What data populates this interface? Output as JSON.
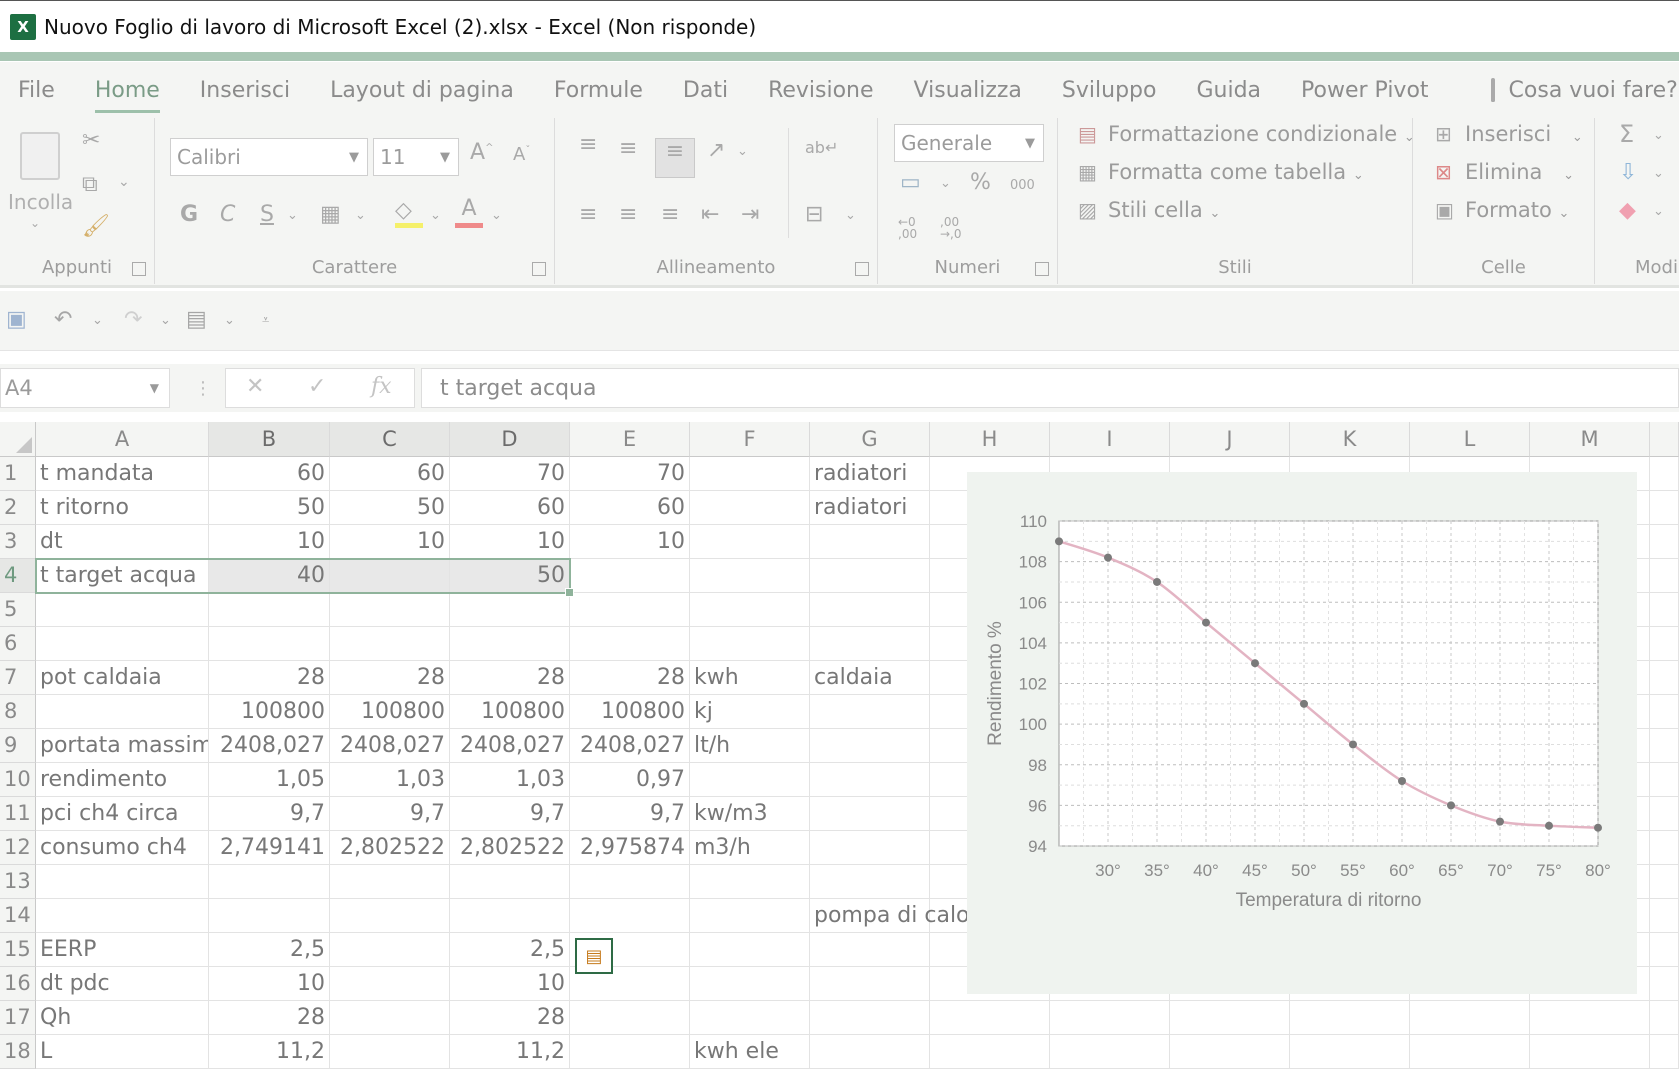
{
  "window": {
    "title": "Nuovo Foglio di lavoro di Microsoft Excel (2).xlsx - Excel (Non risponde)",
    "logo_letter": "X"
  },
  "ribbon_tabs": [
    "File",
    "Home",
    "Inserisci",
    "Layout di pagina",
    "Formule",
    "Dati",
    "Revisione",
    "Visualizza",
    "Sviluppo",
    "Guida",
    "Power Pivot"
  ],
  "tell_me": "Cosa vuoi fare?",
  "ribbon": {
    "appunti": {
      "paste_label": "Incolla",
      "group_label": "Appunti"
    },
    "carattere": {
      "font": "Calibri",
      "size": "11",
      "bold": "G",
      "italic": "C",
      "underline": "S",
      "group_label": "Carattere"
    },
    "allineamento": {
      "group_label": "Allineamento"
    },
    "numeri": {
      "format": "Generale",
      "percent": "%",
      "thousands": "000",
      "inc_dec": "←0 ,00",
      "dec_dec": ",00 →,0",
      "group_label": "Numeri"
    },
    "stili": {
      "conditional": "Formattazione condizionale",
      "as_table": "Formatta come tabella",
      "cell_styles": "Stili cella",
      "group_label": "Stili"
    },
    "celle": {
      "insert": "Inserisci",
      "delete": "Elimina",
      "format": "Formato",
      "group_label": "Celle"
    },
    "modifica": {
      "group_label": "Modi"
    }
  },
  "formula_bar": {
    "name_box": "A4",
    "formula": "t target acqua",
    "fx": "fx"
  },
  "columns": [
    "A",
    "B",
    "C",
    "D",
    "E",
    "F",
    "G",
    "H",
    "I",
    "J",
    "K",
    "L",
    "M"
  ],
  "rows": [
    {
      "n": "1",
      "A": "t mandata",
      "B": "60",
      "C": "60",
      "D": "70",
      "E": "70",
      "F": "",
      "G": "radiatori"
    },
    {
      "n": "2",
      "A": "t ritorno",
      "B": "50",
      "C": "50",
      "D": "60",
      "E": "60",
      "F": "",
      "G": "radiatori"
    },
    {
      "n": "3",
      "A": "dt",
      "B": "10",
      "C": "10",
      "D": "10",
      "E": "10",
      "F": "",
      "G": ""
    },
    {
      "n": "4",
      "A": "t target acqua",
      "B": "40",
      "C": "",
      "D": "50",
      "E": "",
      "F": "",
      "G": ""
    },
    {
      "n": "5",
      "A": "",
      "B": "",
      "C": "",
      "D": "",
      "E": "",
      "F": "",
      "G": ""
    },
    {
      "n": "6",
      "A": "",
      "B": "",
      "C": "",
      "D": "",
      "E": "",
      "F": "",
      "G": ""
    },
    {
      "n": "7",
      "A": "pot caldaia",
      "B": "28",
      "C": "28",
      "D": "28",
      "E": "28",
      "F": "kwh",
      "G": "caldaia"
    },
    {
      "n": "8",
      "A": "",
      "B": "100800",
      "C": "100800",
      "D": "100800",
      "E": "100800",
      "F": "kj",
      "G": ""
    },
    {
      "n": "9",
      "A": "portata massima",
      "B": "2408,027",
      "C": "2408,027",
      "D": "2408,027",
      "E": "2408,027",
      "F": "lt/h",
      "G": ""
    },
    {
      "n": "10",
      "A": "rendimento",
      "B": "1,05",
      "C": "1,03",
      "D": "1,03",
      "E": "0,97",
      "F": "",
      "G": ""
    },
    {
      "n": "11",
      "A": "pci ch4 circa",
      "B": "9,7",
      "C": "9,7",
      "D": "9,7",
      "E": "9,7",
      "F": "kw/m3",
      "G": ""
    },
    {
      "n": "12",
      "A": "consumo ch4",
      "B": "2,749141",
      "C": "2,802522",
      "D": "2,802522",
      "E": "2,975874",
      "F": "m3/h",
      "G": ""
    },
    {
      "n": "13",
      "A": "",
      "B": "",
      "C": "",
      "D": "",
      "E": "",
      "F": "",
      "G": ""
    },
    {
      "n": "14",
      "A": "",
      "B": "",
      "C": "",
      "D": "",
      "E": "",
      "F": "",
      "G": "pompa di calo"
    },
    {
      "n": "15",
      "A": "EERP",
      "B": "2,5",
      "C": "",
      "D": "2,5",
      "E": "",
      "F": "",
      "G": ""
    },
    {
      "n": "16",
      "A": "dt pdc",
      "B": "10",
      "C": "",
      "D": "10",
      "E": "",
      "F": "",
      "G": ""
    },
    {
      "n": "17",
      "A": "Qh",
      "B": "28",
      "C": "",
      "D": "28",
      "E": "",
      "F": "",
      "G": ""
    },
    {
      "n": "18",
      "A": "L",
      "B": "11,2",
      "C": "",
      "D": "11,2",
      "E": "",
      "F": "kwh ele",
      "G": ""
    }
  ],
  "chart_data": {
    "type": "line",
    "title": "",
    "xlabel": "Temperatura di ritorno",
    "ylabel": "Rendimento %",
    "x": [
      25,
      30,
      35,
      40,
      45,
      50,
      55,
      60,
      65,
      70,
      75,
      80
    ],
    "x_tick_labels": [
      "30°",
      "35°",
      "40°",
      "45°",
      "50°",
      "55°",
      "60°",
      "65°",
      "70°",
      "75°",
      "80°"
    ],
    "x_ticks": [
      30,
      35,
      40,
      45,
      50,
      55,
      60,
      65,
      70,
      75,
      80
    ],
    "y": [
      109,
      108.2,
      107,
      105,
      103,
      101,
      99,
      97.2,
      96,
      95.2,
      95,
      94.9
    ],
    "ylim": [
      94,
      110
    ],
    "xlim": [
      25,
      80
    ],
    "y_ticks": [
      94,
      96,
      98,
      100,
      102,
      104,
      106,
      108,
      110
    ],
    "grid": true,
    "line_color": "#e3b4c3",
    "marker_color": "#7a7a7a",
    "legend": "none"
  }
}
